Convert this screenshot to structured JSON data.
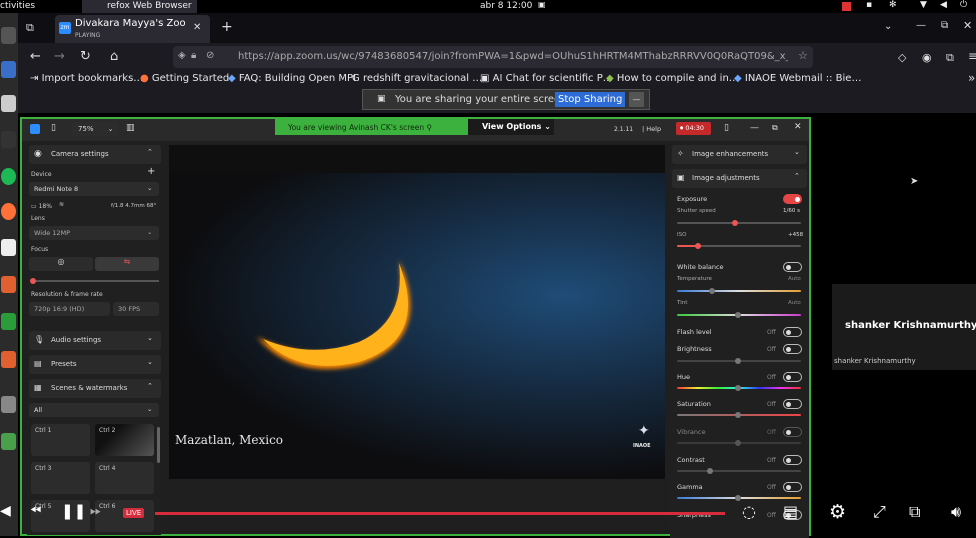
{
  "system": {
    "activities": "ctivities",
    "clock": "abr 8  12:00",
    "app_label": "refox Web Browser"
  },
  "tab": {
    "title": "Divakara Mayya's Zoom M",
    "status": "PLAYING",
    "favicon": "zm"
  },
  "url": "https://app.zoom.us/wc/97483680547/join?fromPWA=1&pwd=OUhuS1hHRTM4MThabzRRRVV0Q0RaQT09&_x_zm_rt",
  "bookmarks": [
    "Import bookmarks…",
    "Getting Started",
    "FAQ: Building Open MPI",
    "redshift gravitacional …",
    "AI Chat for scientific P…",
    "How to compile and in…",
    "INAOE Webmail :: Bie…"
  ],
  "share_bar": {
    "text": "You are sharing your entire screen.",
    "button": "Stop Sharing",
    "minimize": "—"
  },
  "zoom": {
    "zoom_level": "75%",
    "viewing_banner": "You are viewing  Avinash CK's screen",
    "view_options": "View Options",
    "version": "2.1.11",
    "help": "Help",
    "rec_time": "04:30"
  },
  "left_panel": {
    "camera_settings": "Camera settings",
    "device_label": "Device",
    "device_value": "Redmi Note 8",
    "battery": "18%",
    "lens_info": "f/1.8  4.7mm  68°",
    "lens_label": "Lens",
    "lens_value": "Wide 12MP",
    "focus_label": "Focus",
    "resolution_label": "Resolution & frame rate",
    "resolution_value": "720p 16:9 (HD)",
    "fps_value": "30 FPS",
    "audio_settings": "Audio settings",
    "presets": "Presets",
    "scenes": "Scenes & watermarks",
    "scenes_filter": "All",
    "ctrl": [
      "Ctrl 1",
      "Ctrl 2",
      "Ctrl 3",
      "Ctrl 4",
      "Ctrl 5",
      "Ctrl 6"
    ]
  },
  "video": {
    "caption": "Mazatlan, Mexico",
    "logo_text": "INAOE"
  },
  "right_panel": {
    "image_enhancements": "Image enhancements",
    "image_adjustments": "Image adjustments",
    "exposure": "Exposure",
    "shutter_speed": "Shutter speed",
    "shutter_value": "1/60 s",
    "iso": "ISO",
    "iso_value": "+458",
    "white_balance": "White balance",
    "temperature": "Temperature",
    "temperature_value": "Auto",
    "tint": "Tint",
    "tint_value": "Auto",
    "off": "Off",
    "flash_level": "Flash level",
    "brightness": "Brightness",
    "hue": "Hue",
    "saturation": "Saturation",
    "vibrance": "Vibrance",
    "contrast": "Contrast",
    "gamma": "Gamma",
    "sharpness": "Sharpness"
  },
  "participant": {
    "name_big": "shanker Krishnamurthy",
    "name_small": "shanker Krishnamurthy"
  },
  "player": {
    "live": "LIVE"
  }
}
